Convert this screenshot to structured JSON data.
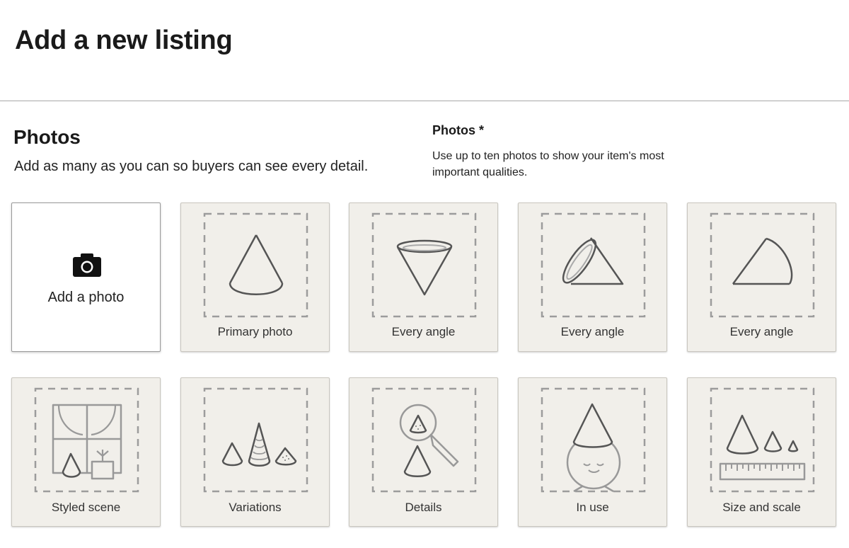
{
  "header": {
    "title": "Add a new listing"
  },
  "photos_section": {
    "heading": "Photos",
    "subtitle": "Add as many as you can so buyers can see every detail.",
    "field_label": "Photos *",
    "field_help": "Use up to ten photos to show your item's most important qualities."
  },
  "tiles": {
    "add_photo": {
      "label": "Add a photo",
      "icon": "camera-icon"
    },
    "slots": [
      {
        "label": "Primary photo",
        "icon": "cone-upright-icon"
      },
      {
        "label": "Every angle",
        "icon": "cone-inverted-icon"
      },
      {
        "label": "Every angle",
        "icon": "cone-tilted-icon"
      },
      {
        "label": "Every angle",
        "icon": "cone-side-icon"
      },
      {
        "label": "Styled scene",
        "icon": "window-scene-icon"
      },
      {
        "label": "Variations",
        "icon": "cone-variations-icon"
      },
      {
        "label": "Details",
        "icon": "magnifier-detail-icon"
      },
      {
        "label": "In use",
        "icon": "cone-hat-face-icon"
      },
      {
        "label": "Size and scale",
        "icon": "ruler-scale-icon"
      }
    ]
  },
  "colors": {
    "tile_background": "#f1efea",
    "tile_border": "#c9c6bf",
    "dashed_frame": "#9c9c9c",
    "divider": "#a8a8a8",
    "text": "#222222"
  }
}
